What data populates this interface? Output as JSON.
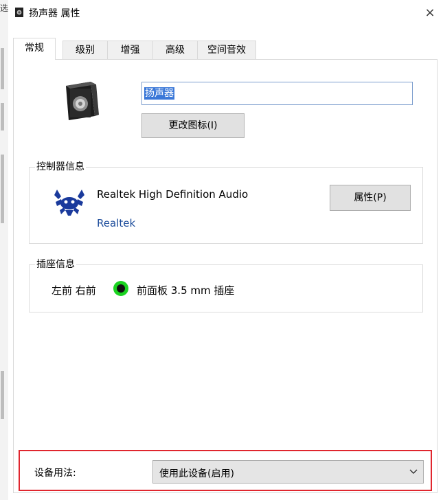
{
  "background": {
    "partial_text": "选"
  },
  "window": {
    "title": "扬声器 属性",
    "close_glyph": "×"
  },
  "tabs": [
    {
      "label": "常规",
      "active": true
    },
    {
      "label": "级别",
      "active": false
    },
    {
      "label": "增强",
      "active": false
    },
    {
      "label": "高级",
      "active": false
    },
    {
      "label": "空间音效",
      "active": false
    }
  ],
  "general": {
    "device_name": "扬声器",
    "change_icon_button": "更改图标(I)"
  },
  "controller": {
    "legend": "控制器信息",
    "name": "Realtek High Definition Audio",
    "vendor": "Realtek",
    "properties_button": "属性(P)"
  },
  "jack": {
    "legend": "插座信息",
    "position": "左前 右前",
    "description": "前面板 3.5 mm 插座",
    "color": "#1bd321"
  },
  "usage": {
    "label": "设备用法:",
    "selected": "使用此设备(启用)"
  },
  "colors": {
    "highlight": "#e0262e",
    "selection": "#3b78d8",
    "vendor_link": "#1f4e9c"
  },
  "icons": [
    "speaker-icon",
    "realtek-crab-logo-icon",
    "close-icon",
    "chevron-down-icon",
    "jack-indicator-icon"
  ]
}
